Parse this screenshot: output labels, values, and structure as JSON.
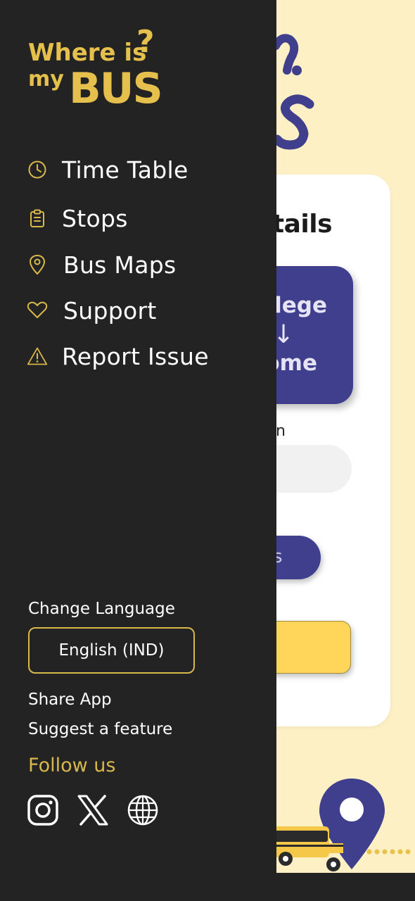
{
  "background": {
    "card_title": "tails",
    "direction_button": {
      "line1": "llege",
      "arrow": "↓",
      "line2": "ome"
    },
    "field_label": "n",
    "pill_button_text": "s"
  },
  "drawer": {
    "logo": {
      "line1": "Where is",
      "line2_small": "my",
      "line2_big": "BUS",
      "mark": "?"
    },
    "menu": [
      {
        "label": "Time Table",
        "icon": "clock-icon"
      },
      {
        "label": "Stops",
        "icon": "clipboard-icon"
      },
      {
        "label": "Bus Maps",
        "icon": "map-pin-icon"
      },
      {
        "label": "Support",
        "icon": "heart-icon"
      },
      {
        "label": "Report Issue",
        "icon": "warning-icon"
      }
    ],
    "change_language_label": "Change Language",
    "language_value": "English (IND)",
    "share_app": "Share App",
    "suggest_feature": "Suggest a feature",
    "follow_us": "Follow us",
    "socials": [
      "instagram-icon",
      "x-icon",
      "globe-icon"
    ]
  },
  "colors": {
    "drawer_bg": "#232323",
    "accent_gold": "#d8b84a",
    "brand_blue": "#3f3f8e",
    "cream": "#fdf0c4",
    "yellow": "#ffd65a"
  }
}
